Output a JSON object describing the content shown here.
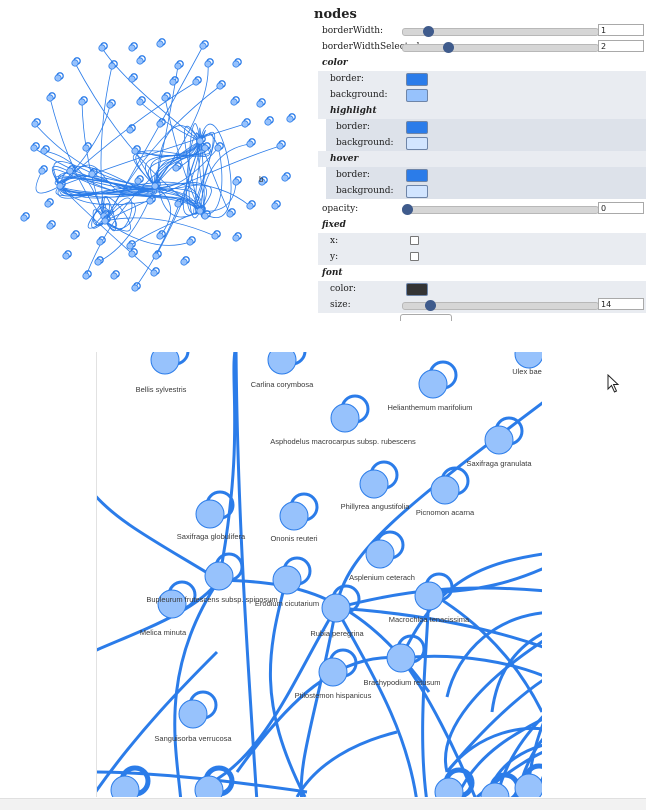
{
  "panel": {
    "title": "nodes",
    "borderWidth": {
      "label": "borderWidth:",
      "value": "1"
    },
    "borderWidthSelected": {
      "label": "borderWidthSelected:",
      "value": "2"
    },
    "color": {
      "section": "color",
      "border_label": "border:",
      "background_label": "background:",
      "border_color": "#2b7ce9",
      "background_color": "#97c2fc"
    },
    "highlight": {
      "section": "highlight",
      "border_label": "border:",
      "background_label": "background:",
      "border_color": "#2b7ce9",
      "background_color": "#d2e5ff"
    },
    "hover": {
      "section": "hover",
      "border_label": "border:",
      "background_label": "background:",
      "border_color": "#2b7ce9",
      "background_color": "#d2e5ff"
    },
    "opacity": {
      "label": "opacity:",
      "value": "0"
    },
    "fixed": {
      "section": "fixed",
      "x_label": "x:",
      "y_label": "y:"
    },
    "font": {
      "section": "font",
      "color_label": "color:",
      "color_value": "#343434",
      "size_label": "size:",
      "size_value": "14"
    }
  },
  "graph": {
    "labels": {
      "n1": "Bellis sylvestris",
      "n2": "Carlina corymbosa",
      "n3": "Ulex bae",
      "n4": "Helianthemum marifolium",
      "n5": "Asphodelus macrocarpus subsp. rubescens",
      "n6": "Saxifraga granulata",
      "n7": "Phillyrea angustifolia",
      "n8": "Picnomon acarna",
      "n9": "Saxifraga globulifera",
      "n10": "Ononis reuteri",
      "n11": "Asplenium ceterach",
      "n12": "Bupleurum frutescens subsp. spinosum",
      "n13": "Erodium cicutarium",
      "n14": "Melica minuta",
      "n15": "Rubia peregrina",
      "n16": "Macrochloa tenacissima",
      "n17": "Brachypodium retusum",
      "n18": "Ptilostemon hispanicus",
      "n19": "Sanguisorba verrucosa"
    },
    "node_fill": "#97c2fc",
    "edge_color": "#2b7ce9"
  }
}
